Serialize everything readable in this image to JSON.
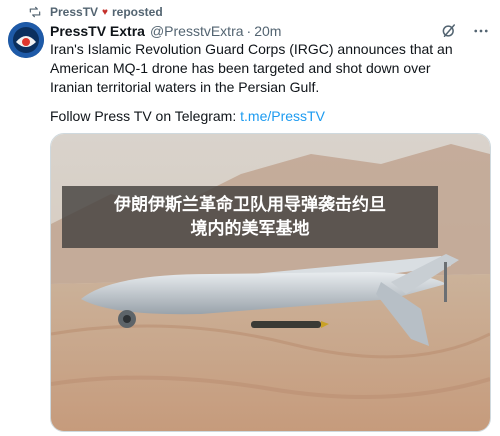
{
  "repost": {
    "user": "PressTV",
    "label": "reposted"
  },
  "post": {
    "display_name": "PressTV Extra",
    "handle": "@PresstvExtra",
    "separator": "·",
    "time": "20m",
    "text": "Iran's Islamic Revolution Guard Corps (IRGC) announces that an American MQ-1 drone has been targeted and shot down over Iranian territorial waters in the Persian Gulf.",
    "follow_prefix": "Follow Press TV on Telegram: ",
    "follow_link": "t.me/PressTV"
  },
  "media": {
    "caption_line1": "伊朗伊斯兰革命卫队用导弹袭击约旦",
    "caption_line2": "境内的美军基地"
  },
  "icons": {
    "repost": "repost-icon",
    "heart": "heart-icon",
    "grok": "grok-icon",
    "more": "more-icon"
  },
  "colors": {
    "link": "#1d9bf0",
    "muted": "#536471",
    "heart": "#c4302b"
  }
}
